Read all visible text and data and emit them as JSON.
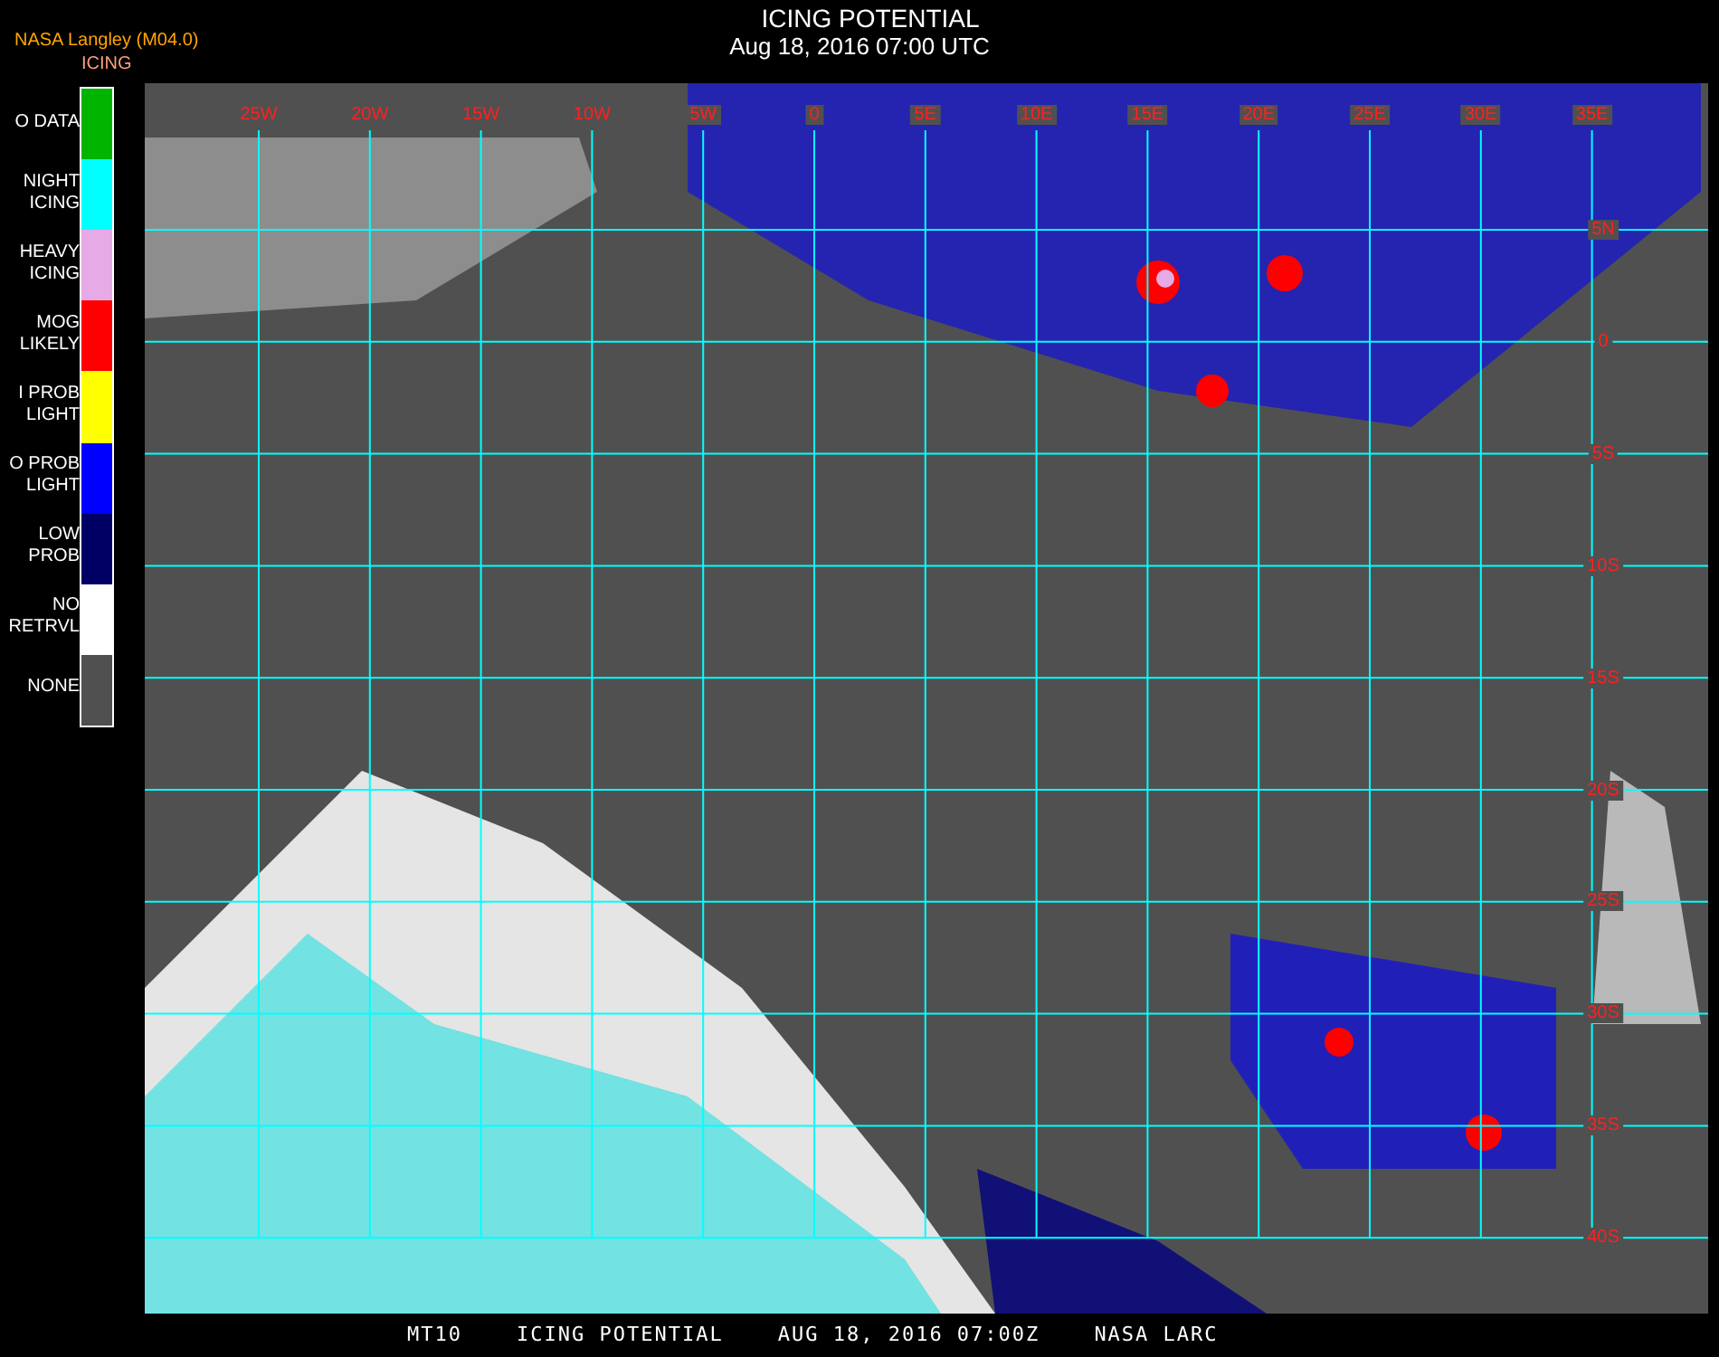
{
  "header": {
    "source": "NASA Langley (M04.0)",
    "product": "ICING",
    "title": "ICING POTENTIAL",
    "subtitle": "Aug 18, 2016 07:00 UTC"
  },
  "legend": [
    {
      "lines": [
        "O DATA"
      ],
      "color": "#00b400"
    },
    {
      "lines": [
        "NIGHT",
        "ICING"
      ],
      "color": "#00ffff"
    },
    {
      "lines": [
        "HEAVY",
        "ICING"
      ],
      "color": "#e6aae6"
    },
    {
      "lines": [
        "MOG",
        "LIKELY"
      ],
      "color": "#ff0000"
    },
    {
      "lines": [
        "I PROB",
        "LIGHT"
      ],
      "color": "#ffff00"
    },
    {
      "lines": [
        "O PROB",
        "LIGHT"
      ],
      "color": "#0000ff"
    },
    {
      "lines": [
        "LOW",
        "PROB"
      ],
      "color": "#000064"
    },
    {
      "lines": [
        "NO",
        "RETRVL"
      ],
      "color": "#ffffff"
    },
    {
      "lines": [
        "NONE"
      ],
      "color": "#505050"
    }
  ],
  "map": {
    "lon_labels": [
      "25W",
      "20W",
      "15W",
      "10W",
      "5W",
      "0",
      "5E",
      "10E",
      "15E",
      "20E",
      "25E",
      "30E",
      "35E"
    ],
    "lat_labels": [
      "5N",
      "0",
      "5S",
      "10S",
      "15S",
      "20S",
      "25S",
      "30S",
      "35S",
      "40S"
    ]
  },
  "footer": [
    "MT10",
    "ICING POTENTIAL",
    "AUG 18, 2016 07:00Z",
    "NASA LARC"
  ]
}
